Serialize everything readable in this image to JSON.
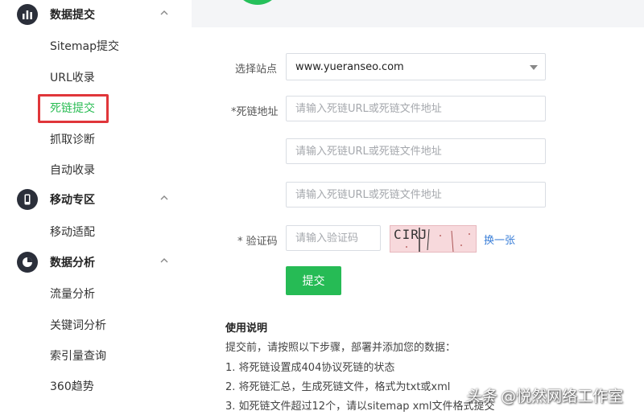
{
  "sidebar": {
    "sections": [
      {
        "title": "数据提交",
        "icon": "bar-chart-icon",
        "items": [
          "Sitemap提交",
          "URL收录",
          "死链提交",
          "抓取诊断",
          "自动收录"
        ]
      },
      {
        "title": "移动专区",
        "icon": "mobile-phone-icon",
        "items": [
          "移动适配"
        ]
      },
      {
        "title": "数据分析",
        "icon": "pie-chart-icon",
        "items": [
          "流量分析",
          "关键词分析",
          "索引量查询",
          "360趋势"
        ]
      }
    ],
    "active_item": "死链提交"
  },
  "form": {
    "site_label": "选择站点",
    "site_value": "www.yueranseo.com",
    "deadlink_label": "*死链地址",
    "deadlink_placeholder": "请输入死链URL或死链文件地址",
    "captcha_label": "* 验证码",
    "captcha_placeholder": "请输入验证码",
    "captcha_text": "CIRJ",
    "refresh_label": "换一张",
    "submit_label": "提交"
  },
  "instructions": {
    "title": "使用说明",
    "intro": "提交前，请按照以下步骤，部署并添加您的数据：",
    "steps": [
      "1. 将死链设置成404协议死链的状态",
      "2. 将死链汇总，生成死链文件，格式为txt或xml",
      "3. 如死链文件超过12个，请以sitemap xml文件格式提交"
    ]
  },
  "watermark": {
    "prefix": "头条",
    "text": "@悦然网络工作室"
  },
  "colors": {
    "accent_green": "#26bb55",
    "highlight_red": "#e0363a",
    "link_blue": "#3b7fd8",
    "icon_dark": "#2b2f3a"
  }
}
